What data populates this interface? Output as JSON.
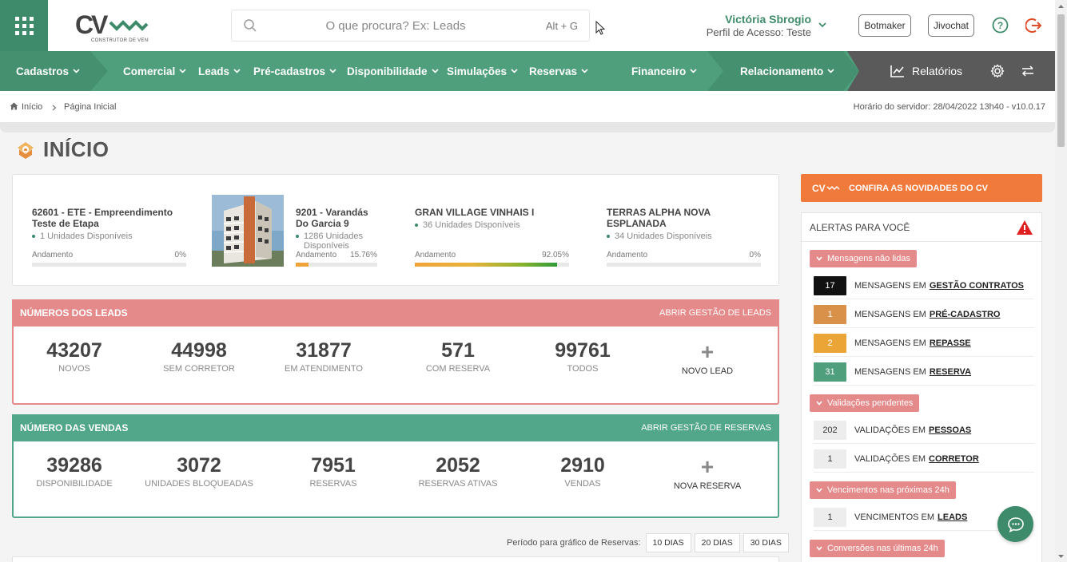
{
  "search": {
    "placeholder": "O que procura? Ex: Leads",
    "shortcut": "Alt + G"
  },
  "logo": {
    "text": "CV",
    "tagline": "CONSTRUTOR DE VENDAS"
  },
  "user": {
    "name": "Victória Sbrogio",
    "profile": "Perfil de Acesso: Teste"
  },
  "top_buttons": {
    "botmaker": "Botmaker",
    "jivochat": "Jivochat"
  },
  "nav": {
    "items": [
      "Cadastros",
      "Comercial",
      "Leads",
      "Pré-cadastros",
      "Disponibilidade",
      "Simulações",
      "Reservas",
      "Financeiro",
      "Relacionamento"
    ],
    "reports": "Relatórios"
  },
  "breadcrumb": {
    "home": "Início",
    "current": "Página Inicial",
    "server_time": "Horário do servidor: 28/04/2022 13h40 - v10.0.17"
  },
  "page_title": "INÍCIO",
  "enterprises": [
    {
      "title": "62601 - ETE - Empreendimento Teste de Etapa",
      "units": "1 Unidades Disponíveis",
      "progress_label": "Andamento",
      "progress": "0%",
      "progress_value": 0
    },
    {
      "title": "9201 - Varandás Do Garcia 9",
      "units": "1286 Unidades Disponíveis",
      "progress_label": "Andamento",
      "progress": "15.76%",
      "progress_value": 15.76
    },
    {
      "title": "GRAN VILLAGE VINHAIS I",
      "units": "36 Unidades Disponíveis",
      "progress_label": "Andamento",
      "progress": "92.05%",
      "progress_value": 92.05
    },
    {
      "title": "TERRAS ALPHA NOVA ESPLANADA",
      "units": "34 Unidades Disponíveis",
      "progress_label": "Andamento",
      "progress": "0%",
      "progress_value": 0
    }
  ],
  "leads": {
    "title": "NÚMEROS DOS LEADS",
    "link": "ABRIR GESTÃO DE LEADS",
    "stats": [
      {
        "value": "43207",
        "label": "NOVOS"
      },
      {
        "value": "44998",
        "label": "SEM CORRETOR"
      },
      {
        "value": "31877",
        "label": "EM ATENDIMENTO"
      },
      {
        "value": "571",
        "label": "COM RESERVA"
      },
      {
        "value": "99761",
        "label": "TODOS"
      }
    ],
    "add_label": "NOVO LEAD",
    "color": "#e58a8a"
  },
  "sales": {
    "title": "NÚMERO DAS VENDAS",
    "link": "ABRIR GESTÃO DE RESERVAS",
    "stats": [
      {
        "value": "39286",
        "label": "DISPONIBILIDADE"
      },
      {
        "value": "3072",
        "label": "UNIDADES BLOQUEADAS"
      },
      {
        "value": "7951",
        "label": "RESERVAS"
      },
      {
        "value": "2052",
        "label": "RESERVAS ATIVAS"
      },
      {
        "value": "2910",
        "label": "VENDAS"
      }
    ],
    "add_label": "NOVA RESERVA",
    "color": "#52a68a"
  },
  "period": {
    "label": "Período para gráfico de Reservas:",
    "options": [
      "10 DIAS",
      "20 DIAS",
      "30 DIAS"
    ]
  },
  "news": {
    "label": "CONFIRA AS NOVIDADES DO CV",
    "color": "#f07a3c"
  },
  "alerts": {
    "title": "ALERTAS PARA VOCÊ",
    "groups": [
      {
        "label": "Mensagens não lidas"
      },
      {
        "label": "Validações pendentes"
      },
      {
        "label": "Vencimentos nas próximas 24h"
      },
      {
        "label": "Conversões nas últimas 24h"
      }
    ],
    "rows": [
      {
        "count": "17",
        "text": "MENSAGENS EM",
        "link": "GESTÃO CONTRATOS",
        "color": "#111111"
      },
      {
        "count": "1",
        "text": "MENSAGENS EM",
        "link": "PRÉ-CADASTRO",
        "color": "#d9914a"
      },
      {
        "count": "2",
        "text": "MENSAGENS EM",
        "link": "REPASSE",
        "color": "#eba436"
      },
      {
        "count": "31",
        "text": "MENSAGENS EM",
        "link": "RESERVA",
        "color": "#4f9f7c"
      },
      {
        "count": "202",
        "text": "VALIDAÇÕES EM",
        "link": "PESSOAS",
        "color": "#ededed"
      },
      {
        "count": "1",
        "text": "VALIDAÇÕES EM",
        "link": "CORRETOR",
        "color": "#ededed"
      },
      {
        "count": "1",
        "text": "VENCIMENTOS EM",
        "link": "LEADS",
        "color": "#ededed"
      }
    ]
  },
  "colors": {
    "primary": "#3d8b6a",
    "nav": "#4f9f7c",
    "alert_red": "#e02020"
  }
}
